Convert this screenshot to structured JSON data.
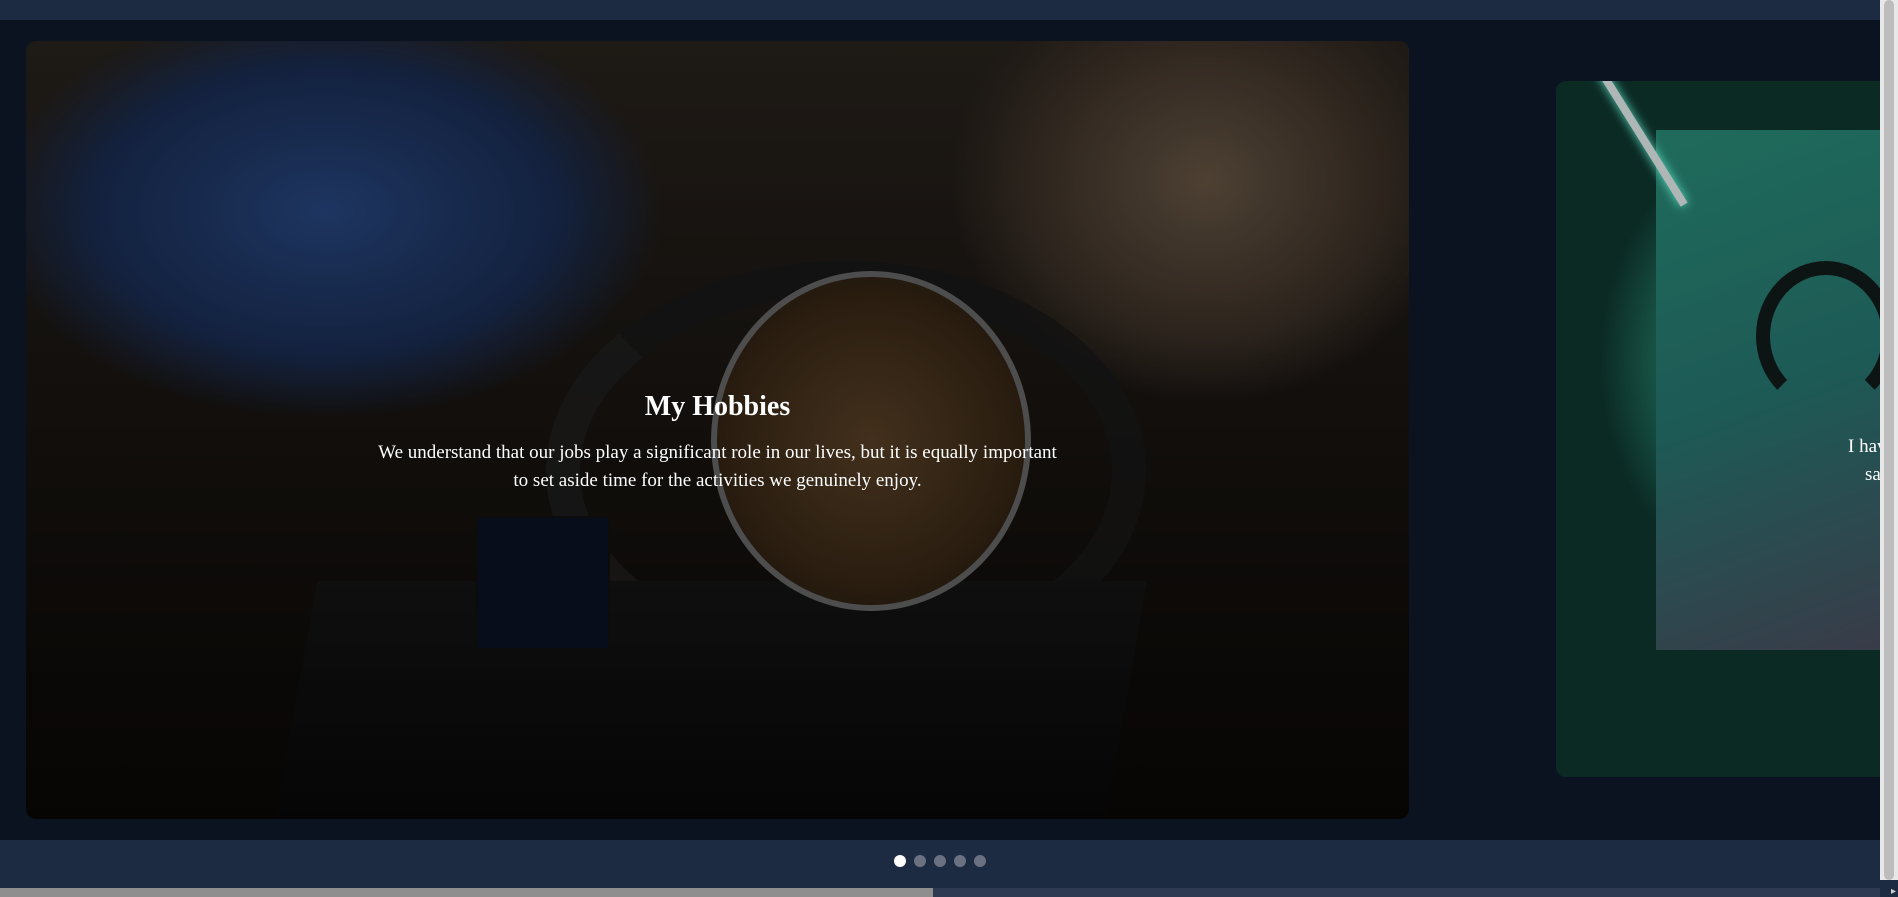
{
  "carousel": {
    "slides": [
      {
        "title": "My Hobbies",
        "description": "We understand that our jobs play a significant role in our lives, but it is equally important to set aside time for the activities we genuinely enjoy."
      },
      {
        "snippet_line1": "I have",
        "snippet_line2": "say"
      }
    ],
    "indicators": {
      "count": 5,
      "active_index": 0
    }
  },
  "colors": {
    "page_bg": "#1c2a42",
    "stage_bg": "#0c1320",
    "dot_active": "#ffffff",
    "dot_inactive": "#6b7180"
  }
}
